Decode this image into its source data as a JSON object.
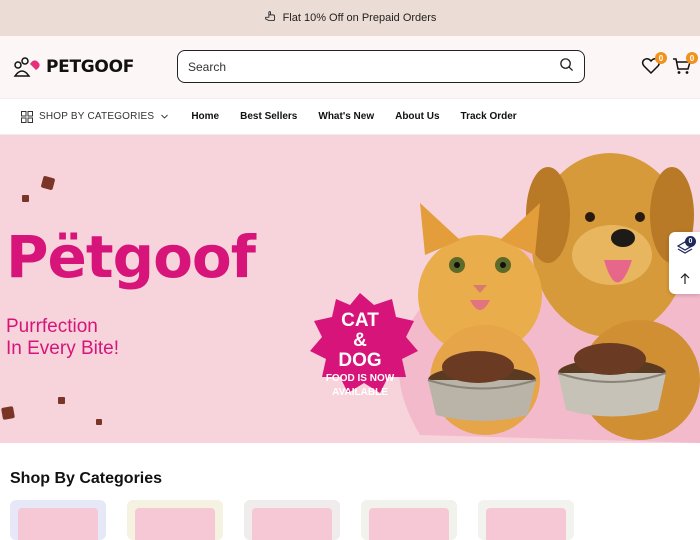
{
  "announcement": {
    "text": "Flat 10% Off on Prepaid Orders"
  },
  "header": {
    "logo_text": "PETGOOF",
    "search_placeholder": "Search",
    "wishlist_count": "0",
    "cart_count": "0"
  },
  "nav": {
    "categories_label": "SHOP BY CATEGORIES",
    "links": [
      "Home",
      "Best Sellers",
      "What's New",
      "About Us",
      "Track Order"
    ]
  },
  "hero": {
    "title": "Pëtgoof",
    "subtitle_line1": "Purrfection",
    "subtitle_line2": "In Every Bite!",
    "burst_line1": "CAT",
    "burst_line2": "&",
    "burst_line3": "DOG",
    "burst_line4": "FOOD IS NOW",
    "burst_line5": "AVAILABLE"
  },
  "floating": {
    "layers_count": "0"
  },
  "categories_section": {
    "title": "Shop By Categories"
  },
  "colors": {
    "brand_pink": "#d61479",
    "badge_orange": "#f0931e",
    "hero_bg": "#f7d4dc"
  }
}
